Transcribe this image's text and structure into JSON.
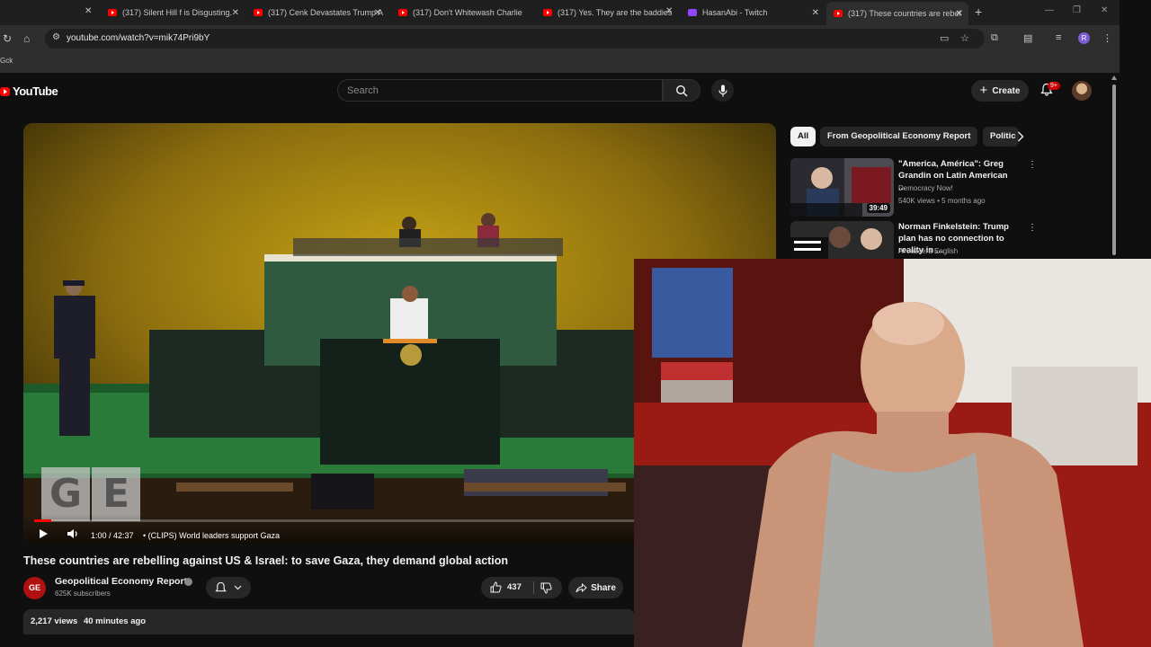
{
  "browser": {
    "tabs": [
      {
        "title": "(317) Silent Hill f is Disgusting.",
        "icon": "youtube-icon"
      },
      {
        "title": "(317) Cenk Devastates Trump A",
        "icon": "youtube-icon"
      },
      {
        "title": "(317) Don't Whitewash Charlie",
        "icon": "youtube-icon"
      },
      {
        "title": "(317) Yes. They are the baddies",
        "icon": "youtube-icon"
      },
      {
        "title": "HasanAbi - Twitch",
        "icon": "twitch-icon"
      },
      {
        "title": "(317) These countries are rebel",
        "icon": "youtube-icon"
      }
    ],
    "url": "youtube.com/watch?v=mik74Pri9bY",
    "bookmark": "Gck",
    "profile_initial": "R"
  },
  "youtube": {
    "logo_text": "YouTube",
    "search_placeholder": "Search",
    "create_label": "Create",
    "notification_count": "9+"
  },
  "player": {
    "time": "1:00 / 42:37",
    "chapter": "• (CLIPS) World leaders support Gaza",
    "progress_fraction": 0.0235,
    "watermark_letters": [
      "G",
      "E"
    ]
  },
  "video": {
    "title": "These countries are rebelling against US & Israel: to save Gaza, they demand global action",
    "channel_name": "Geopolitical Economy Report",
    "channel_avatar_text": "GE",
    "subscribers": "625K subscribers",
    "likes": "437",
    "share_label": "Share",
    "views": "2,217 views",
    "posted": "40 minutes ago"
  },
  "sidebar": {
    "chips": [
      "All",
      "From Geopolitical Economy Report",
      "Politic"
    ],
    "recommendations": [
      {
        "title": "\"America, América\": Greg Grandin on Latin American ...",
        "channel": "Democracy Now!",
        "meta": "540K views • 5 months ago",
        "duration": "39:49"
      },
      {
        "title": "Norman Finkelstein: Trump plan has no connection to reality in ...",
        "channel": "Al Jazeera English",
        "meta": "",
        "duration": ""
      }
    ]
  },
  "colors": {
    "background": "#0f0f0f",
    "accent_red": "#ff0000",
    "chip_bg": "#272727"
  }
}
